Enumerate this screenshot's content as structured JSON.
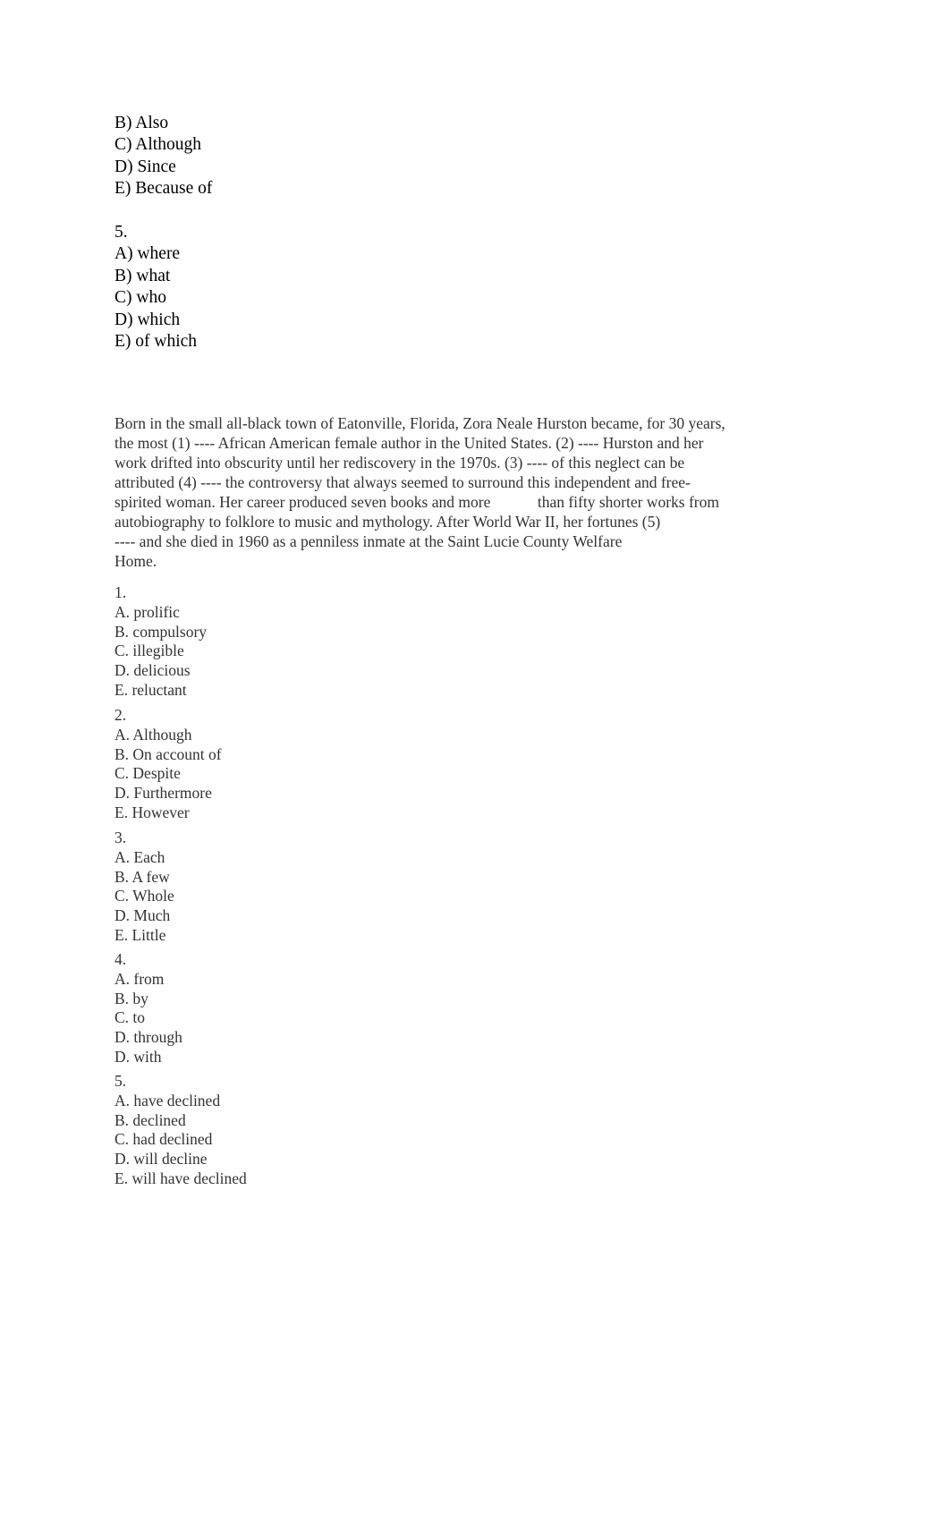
{
  "top_options_continued": {
    "options": [
      "B) Also",
      "C) Although",
      "D) Since",
      "E) Because of"
    ]
  },
  "top_question_5": {
    "number": "5.",
    "options": [
      "A) where",
      "B) what",
      "C) who",
      "D) which",
      "E) of which"
    ]
  },
  "passage": {
    "lines": [
      "Born in the small all-black town of Eatonville, Florida, Zora Neale Hurston became, for 30 years,",
      "the most (1) ---- African American female author in the United States. (2) ---- Hurston and her",
      "work drifted into obscurity until her rediscovery in the 1970s. (3) ---- of this neglect can be",
      "attributed (4) ---- the controversy that always seemed to surround this independent and free-",
      "spirited woman. Her career produced seven books and more            than fifty shorter works from",
      "autobiography to folklore to music and mythology. After World War II, her fortunes (5)",
      "---- and she died in 1960 as a penniless inmate at the Saint Lucie County Welfare",
      "Home."
    ]
  },
  "questions": [
    {
      "number": "1.",
      "options": [
        "A. prolific",
        "B. compulsory",
        "C. illegible",
        "D. delicious",
        "E. reluctant"
      ]
    },
    {
      "number": "2.",
      "options": [
        "A. Although",
        "B. On account of",
        "C. Despite",
        "D. Furthermore",
        "E. However"
      ]
    },
    {
      "number": "3.",
      "options": [
        "A. Each",
        "B. A few",
        "C. Whole",
        "D. Much",
        "E. Little"
      ]
    },
    {
      "number": "4.",
      "options": [
        "A. from",
        "B. by",
        "C. to",
        "D. through",
        "D. with"
      ]
    },
    {
      "number": "5.",
      "options": [
        "A. have declined",
        "B. declined",
        "C. had declined",
        "D. will decline",
        "E. will have declined"
      ]
    }
  ]
}
